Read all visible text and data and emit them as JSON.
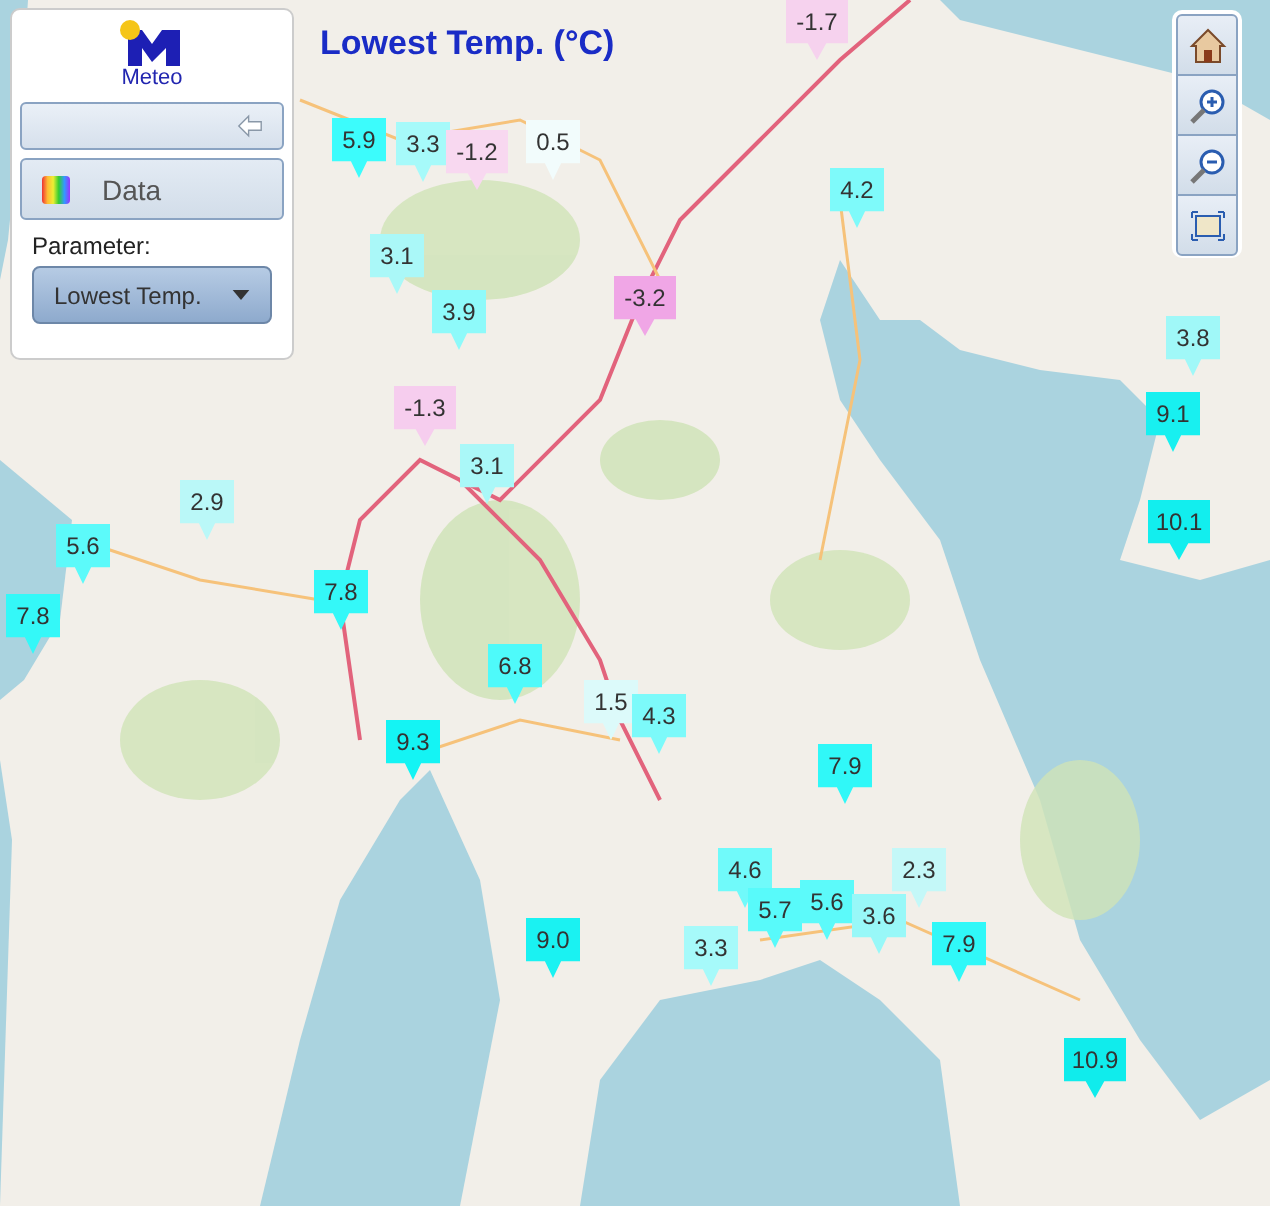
{
  "panel": {
    "logo_text": "Meteo",
    "data_button": "Data",
    "parameter_label": "Parameter:",
    "parameter_select": {
      "value": "Lowest Temp."
    }
  },
  "map": {
    "title": "Lowest Temp. (°C)",
    "markers": [
      {
        "value": "-1.7",
        "color": "#f6d2ee"
      },
      {
        "value": "5.9",
        "color": "#3cfcfc"
      },
      {
        "value": "3.3",
        "color": "#a6fafa"
      },
      {
        "value": "-1.2",
        "color": "#f8d8f0"
      },
      {
        "value": "0.5",
        "color": "#f2fcfc"
      },
      {
        "value": "3.1",
        "color": "#aaf8f8"
      },
      {
        "value": "3.9",
        "color": "#8efafa"
      },
      {
        "value": "-3.2",
        "color": "#f0a6e6"
      },
      {
        "value": "4.2",
        "color": "#7efafa"
      },
      {
        "value": "3.8",
        "color": "#a0f8f8"
      },
      {
        "value": "9.1",
        "color": "#18f0f0"
      },
      {
        "value": "10.1",
        "color": "#12eeee"
      },
      {
        "value": "-1.3",
        "color": "#f6cdee"
      },
      {
        "value": "3.1",
        "color": "#aaf8f8"
      },
      {
        "value": "2.9",
        "color": "#baf8f8"
      },
      {
        "value": "5.6",
        "color": "#5cfafa"
      },
      {
        "value": "7.8",
        "color": "#34f8f8"
      },
      {
        "value": "7.8",
        "color": "#34f8f8"
      },
      {
        "value": "6.8",
        "color": "#4efafa"
      },
      {
        "value": "9.3",
        "color": "#14f4f4"
      },
      {
        "value": "1.5",
        "color": "#dcfafa"
      },
      {
        "value": "4.3",
        "color": "#7cfafa"
      },
      {
        "value": "7.9",
        "color": "#30f8f8"
      },
      {
        "value": "4.6",
        "color": "#70fafa"
      },
      {
        "value": "5.7",
        "color": "#58fafa"
      },
      {
        "value": "5.6",
        "color": "#5cfafa"
      },
      {
        "value": "3.6",
        "color": "#98f8f8"
      },
      {
        "value": "2.3",
        "color": "#c4f8f8"
      },
      {
        "value": "3.3",
        "color": "#a6fafa"
      },
      {
        "value": "9.0",
        "color": "#1af2f2"
      },
      {
        "value": "7.9",
        "color": "#30f8f8"
      },
      {
        "value": "10.9",
        "color": "#10ecec"
      }
    ]
  }
}
